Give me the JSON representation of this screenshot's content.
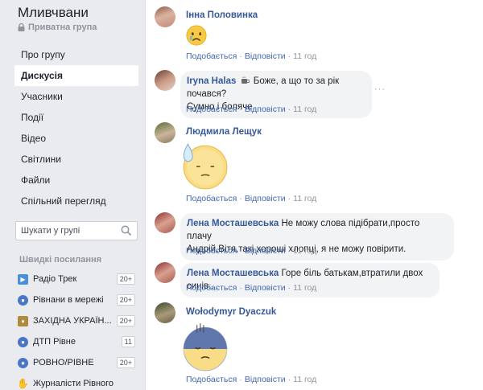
{
  "group": {
    "name": "Мливчвани",
    "privacy": "Приватна група"
  },
  "nav": [
    {
      "label": "Про групу",
      "active": false
    },
    {
      "label": "Дискусія",
      "active": true
    },
    {
      "label": "Учасники",
      "active": false
    },
    {
      "label": "Події",
      "active": false
    },
    {
      "label": "Відео",
      "active": false
    },
    {
      "label": "Світлини",
      "active": false
    },
    {
      "label": "Файли",
      "active": false
    },
    {
      "label": "Спільний перегляд",
      "active": false
    }
  ],
  "search": {
    "placeholder": "Шукати у групі"
  },
  "quick_links": {
    "title": "Швидкі посилання",
    "items": [
      {
        "label": "Радіо Трек",
        "badge": "20+",
        "icon": "play-icon",
        "color": "#4a90d9"
      },
      {
        "label": "Рівнани в мережі",
        "badge": "20+",
        "icon": "group-icon",
        "color": "#4a76c7"
      },
      {
        "label": "ЗАХІДНА УКРАЇН...",
        "badge": "20+",
        "icon": "emblem-icon",
        "color": "#b08a3c"
      },
      {
        "label": "ДТП Рівне",
        "badge": "11",
        "icon": "group-icon",
        "color": "#4a76c7"
      },
      {
        "label": "РОВНО/РІВНЕ",
        "badge": "20+",
        "icon": "group-icon",
        "color": "#4a76c7"
      },
      {
        "label": "Журналісти Рівного",
        "badge": "",
        "icon": "rock-hand-icon",
        "color": "#c08a4a"
      }
    ]
  },
  "actions": {
    "like": "Подобається",
    "reply": "Відповісти"
  },
  "comments": [
    {
      "author": "Інна Половинка",
      "text": "",
      "emoji": "sad-tear-emoji",
      "time": "11 год"
    },
    {
      "author": "Iryna Halas",
      "text_a": "Боже, а що то за рік почався?",
      "text_b": "Сумно і боляче.",
      "time": "11 год"
    },
    {
      "author": "Людмила Лещук",
      "text": "",
      "emoji": "sweat-emoji",
      "time": "11 год"
    },
    {
      "author": "Лена Мосташевська",
      "text_a": "Не можу слова підібрати,просто плачу",
      "text_b": "Андрій,Вітя,такі хороші хлопці, я не можу повірити.",
      "time": "11 год"
    },
    {
      "author": "Лена Мосташевська",
      "text_a": "Горе біль батькам,втратили двох синів..",
      "time": "11 год"
    },
    {
      "author": "Wołodymyr Dyaczuk",
      "text": "",
      "emoji": "gloom-emoji",
      "time": "11 год"
    }
  ],
  "colors": {
    "link": "#365899",
    "bubble": "#f2f3f5",
    "sidebar": "#e9ebee"
  }
}
